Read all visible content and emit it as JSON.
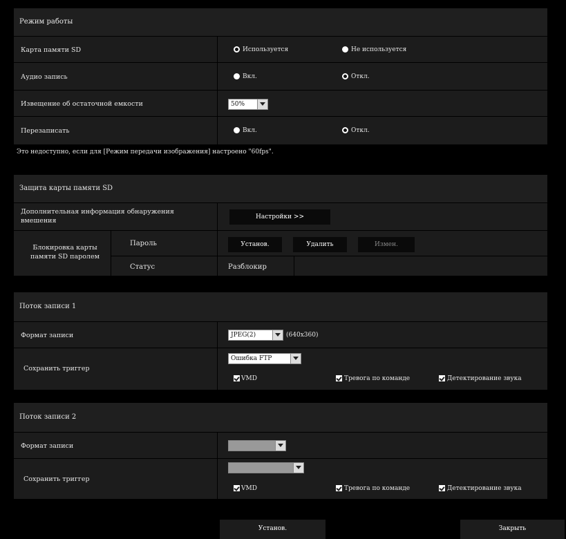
{
  "mode": {
    "title": "Режим работы",
    "sd_card": {
      "label": "Карта памяти SD",
      "opt_use": "Используется",
      "opt_not_use": "Не используется"
    },
    "audio": {
      "label": "Аудио запись",
      "opt_on": "Вкл.",
      "opt_off": "Откл."
    },
    "low_space": {
      "label": "Извещение об остаточной емкости",
      "value": "50%"
    },
    "overwrite": {
      "label": "Перезаписать",
      "opt_on": "Вкл.",
      "opt_off": "Откл."
    },
    "note": "Это недоступно, если для [Режим передачи изображения] настроено \"60fps\"."
  },
  "protect": {
    "title": "Защита карты памяти SD",
    "extra_info": {
      "label": "Дополнительная информация обнаружения вмешения",
      "button": "Настройки >>"
    },
    "lock": {
      "label": "Блокировка карты памяти SD паролем",
      "password_label": "Пароль",
      "btn_set": "Установ.",
      "btn_delete": "Удалить",
      "btn_change": "Измен.",
      "status_label": "Статус",
      "status_value": "Разблокир"
    }
  },
  "stream1": {
    "title": "Поток записи 1",
    "format_label": "Формат записи",
    "format_value": "JPEG(2)",
    "format_res": "(640x360)",
    "trigger_label": "Сохранить триггер",
    "trigger_value": "Ошибка FTP",
    "chk_vmd": "VMD",
    "chk_alarm": "Тревога по команде",
    "chk_audio": "Детектирование звука"
  },
  "stream2": {
    "title": "Поток записи 2",
    "format_label": "Формат записи",
    "trigger_label": "Сохранить триггер",
    "chk_vmd": "VMD",
    "chk_alarm": "Тревога по команде",
    "chk_audio": "Детектирование звука"
  },
  "footer": {
    "set": "Установ.",
    "close": "Закрыть"
  }
}
